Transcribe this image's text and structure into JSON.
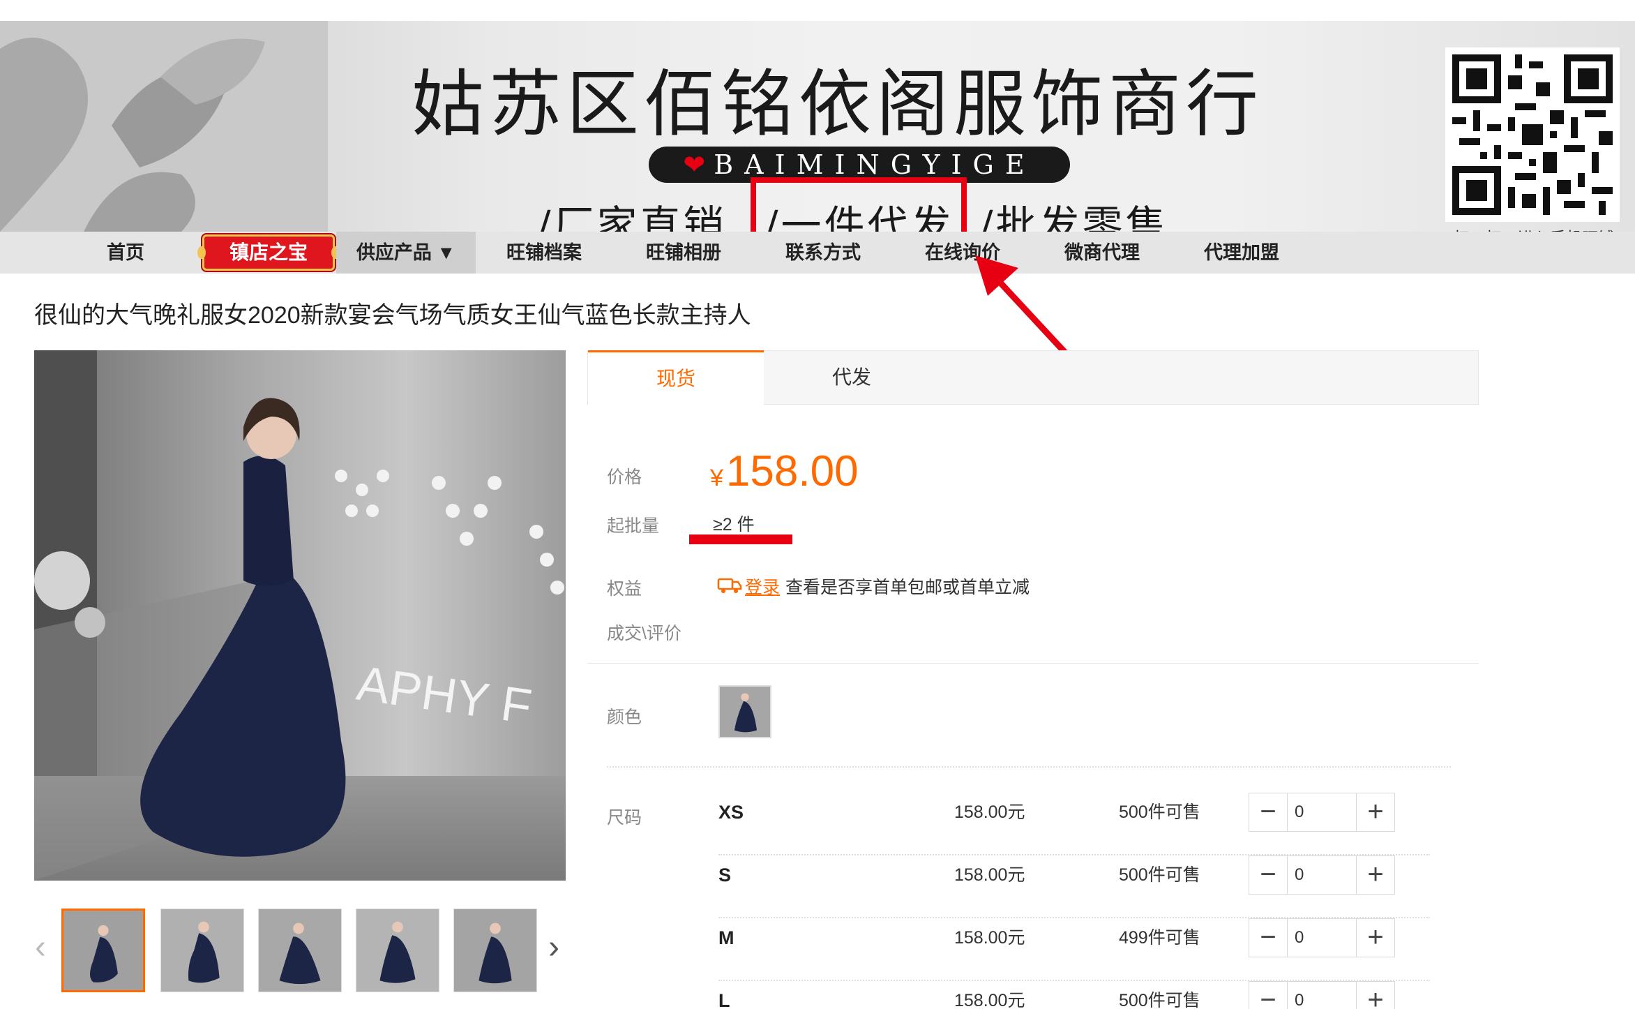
{
  "banner": {
    "shop_name": "姑苏区佰铭依阁服饰商行",
    "brand_en": "BAIMINGYIGE",
    "tagline": [
      "/厂家直销",
      "/一件代发",
      "/批发零售"
    ],
    "qr_caption": "扫一扫，进入手机旺铺",
    "highlight_color": "#e60012"
  },
  "nav": {
    "items": [
      "首页",
      "镇店之宝",
      "供应产品 ▼",
      "旺铺档案",
      "旺铺相册",
      "联系方式",
      "在线询价",
      "微商代理",
      "代理加盟"
    ]
  },
  "product": {
    "title": "很仙的大气晚礼服女2020新款宴会气场气质女王仙气蓝色长款主持人",
    "tabs": [
      "现货",
      "代发"
    ],
    "active_tab": "现货",
    "price_label": "价格",
    "currency": "¥",
    "price": "158.00",
    "moq_label": "起批量",
    "moq_value": "≥2 件",
    "benefit_label": "权益",
    "benefit_login": "登录",
    "benefit_text": "查看是否享首单包邮或首单立减",
    "deals_label": "成交\\评价",
    "color_label": "颜色",
    "size_label": "尺码",
    "sizes": [
      {
        "name": "XS",
        "price": "158.00元",
        "stock": "500件可售",
        "qty": "0"
      },
      {
        "name": "S",
        "price": "158.00元",
        "stock": "500件可售",
        "qty": "0"
      },
      {
        "name": "M",
        "price": "158.00元",
        "stock": "499件可售",
        "qty": "0"
      },
      {
        "name": "L",
        "price": "158.00元",
        "stock": "500件可售",
        "qty": "0"
      }
    ]
  },
  "colors": {
    "accent": "#ff6a00",
    "dress": "#1d2547",
    "nav_bg": "#e5e5e5"
  },
  "icons": [
    "shop-qr-code",
    "heart-icon",
    "red-arrow-icon",
    "coupon-truck-icon",
    "chevron-left-icon",
    "chevron-right-icon",
    "minus-icon",
    "plus-icon"
  ]
}
